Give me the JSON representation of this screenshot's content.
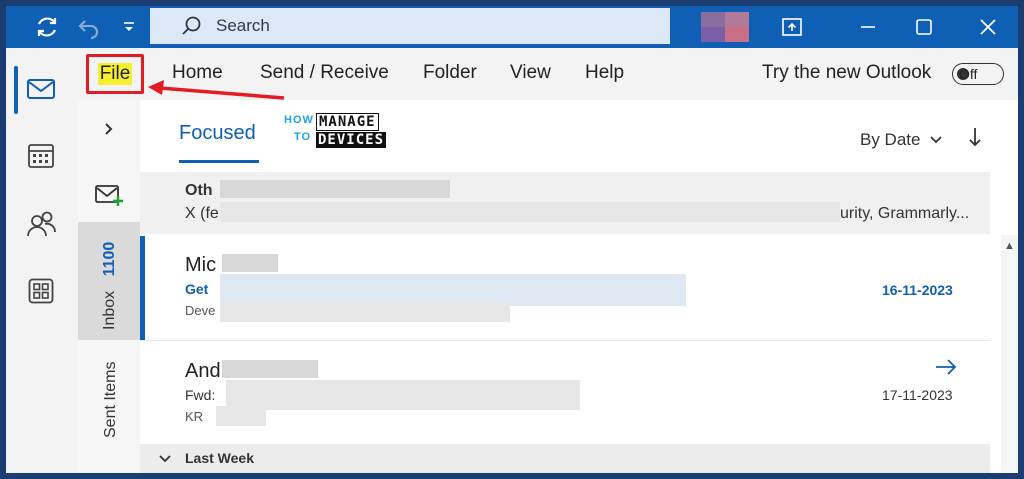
{
  "titlebar": {
    "search_placeholder": "Search"
  },
  "menu": {
    "file": "File",
    "home": "Home",
    "send_receive": "Send / Receive",
    "folder": "Folder",
    "view": "View",
    "help": "Help",
    "try_new": "Try the new Outlook",
    "toggle_state": "Off"
  },
  "folders": {
    "inbox": "Inbox",
    "inbox_count": "1100",
    "sent": "Sent Items"
  },
  "list": {
    "focused_tab": "Focused",
    "sort_label": "By Date",
    "other_label": "Oth",
    "other_preview_start": "X (fe",
    "other_preview_end": "urity, Grammarly...",
    "messages": [
      {
        "sender": "Mic",
        "subject": "Get",
        "preview": "Deve",
        "date": "16-11-2023"
      },
      {
        "sender": "And",
        "subject": "Fwd:",
        "preview": "KR",
        "date": "17-11-2023"
      }
    ],
    "group_last_week": "Last Week"
  },
  "watermark": {
    "how": "HOW",
    "to": "TO",
    "manage": "MANAGE",
    "devices": "DEVICES"
  },
  "colors": {
    "accent": "#0f5fb4",
    "annotation_red": "#e21b25",
    "highlight_yellow": "#f5ef2f"
  }
}
